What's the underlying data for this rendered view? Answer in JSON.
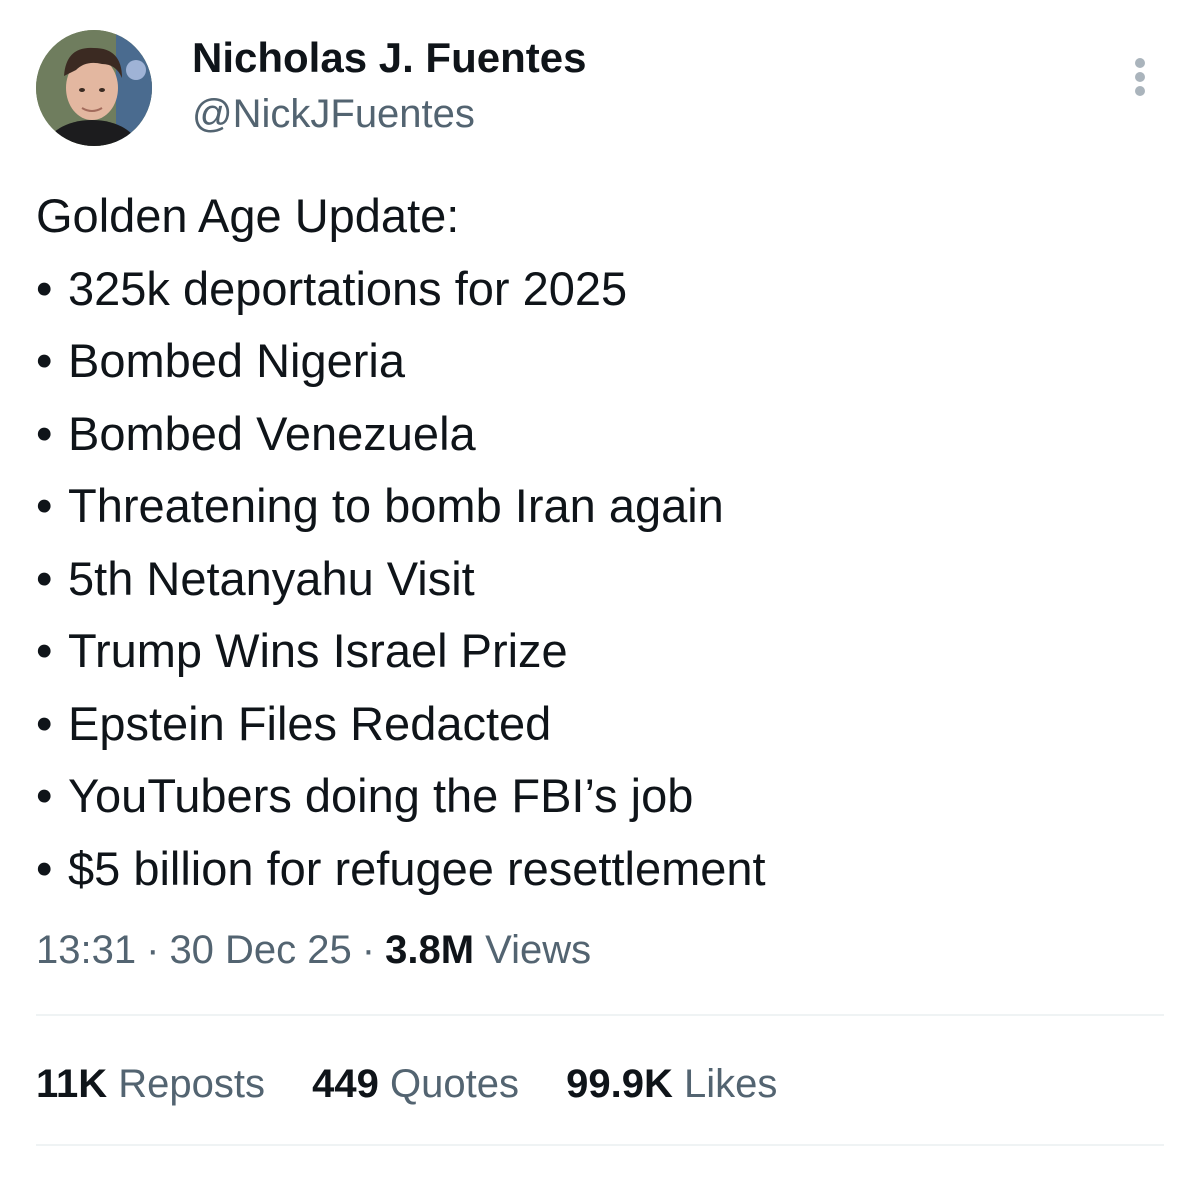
{
  "author": {
    "display_name": "Nicholas J. Fuentes",
    "handle": "@NickJFuentes"
  },
  "menu_icon": "more-vertical-icon",
  "tweet": {
    "lines": [
      "Golden Age Update:",
      "325k deportations for 2025",
      "Bombed Nigeria",
      "Bombed Venezuela",
      "Threatening to bomb Iran again",
      "5th Netanyahu Visit",
      "Trump Wins Israel Prize",
      "Epstein Files Redacted",
      "YouTubers doing the FBI’s job",
      "$5 billion for refugee resettlement"
    ],
    "bullet": "•"
  },
  "meta": {
    "time": "13:31",
    "date": "30 Dec 25",
    "separator": "·",
    "views_count": "3.8M",
    "views_label": "Views"
  },
  "stats": {
    "reposts_count": "11K",
    "reposts_label": "Reposts",
    "quotes_count": "449",
    "quotes_label": "Quotes",
    "likes_count": "99.9K",
    "likes_label": "Likes"
  },
  "colors": {
    "text_primary": "#0f1419",
    "text_secondary": "#536471",
    "divider": "#eff3f4",
    "menu_dots": "#aab4bc"
  }
}
